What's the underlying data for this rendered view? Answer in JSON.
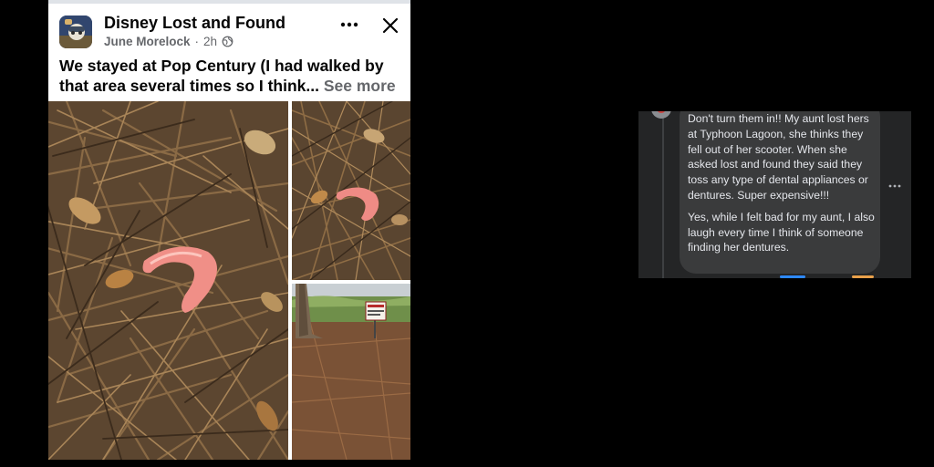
{
  "post": {
    "group_name": "Disney Lost and Found",
    "author": "June Morelock",
    "separator": "·",
    "time": "2h",
    "text": "We stayed at Pop Century (I had walked by that area several times so I think...",
    "see_more": "See more",
    "icons": {
      "more": "more-horizontal-icon",
      "close": "close-icon",
      "audience": "globe-icon"
    },
    "photos": [
      {
        "label": "retainer-on-pine-needles-closeup"
      },
      {
        "label": "retainer-on-pine-needles-wide"
      },
      {
        "label": "tree-and-sign-area"
      }
    ]
  },
  "comment": {
    "paragraphs": [
      "Don't turn them in!! My aunt lost hers at Typhoon Lagoon, she thinks they fell out of her scooter. When she asked lost and found they said they toss any type of dental appliances or dentures. Super expensive!!!",
      "Yes, while I felt bad for my aunt, I also laugh every time I think of someone finding her dentures."
    ],
    "icons": {
      "more": "more-horizontal-icon"
    }
  },
  "colors": {
    "page_background": "#000000",
    "card_background": "#ffffff",
    "primary_text": "#050505",
    "secondary_text": "#65676b",
    "comment_panel": "#242526",
    "comment_bubble": "#3a3b3c",
    "comment_text": "#e4e6eb"
  }
}
